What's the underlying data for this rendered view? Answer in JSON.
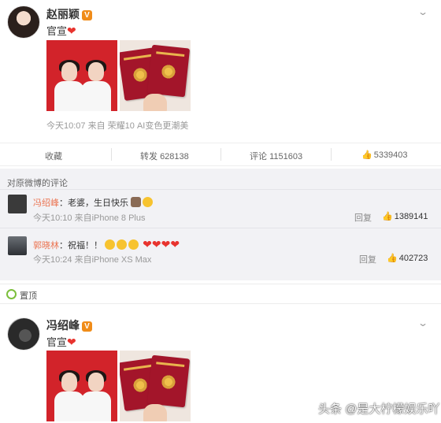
{
  "post1": {
    "username": "赵丽颖",
    "verified_badge": "V",
    "text": "官宣",
    "emoji": "❤",
    "time": "今天10:07",
    "source": "来自 荣耀10 AI变色更潮美"
  },
  "actions": {
    "favorite": "收藏",
    "repost_label": "转发",
    "repost_count": "628138",
    "comment_label": "评论",
    "comment_count": "1151603",
    "like_count": "5339403"
  },
  "comments": {
    "header": "对原微博的评论",
    "items": [
      {
        "user": "冯绍峰",
        "text": "老婆，生日快乐",
        "time": "今天10:10",
        "source": "来自iPhone 8 Plus",
        "reply": "回复",
        "likes": "1389141"
      },
      {
        "user": "郭晓林",
        "text": "祝福！！",
        "time": "今天10:24",
        "source": "来自iPhone XS Max",
        "reply": "回复",
        "likes": "402723"
      }
    ]
  },
  "pinned": {
    "label": "置顶"
  },
  "post2": {
    "username": "冯绍峰",
    "verified_badge": "V",
    "text": "官宣",
    "emoji": "❤"
  },
  "watermark": "头条 @是大柠檬娱乐吖",
  "colors": {
    "accent": "#eb7350",
    "verified": "#f08c19",
    "heart": "#e8332e",
    "photo_red": "#d2232a"
  }
}
